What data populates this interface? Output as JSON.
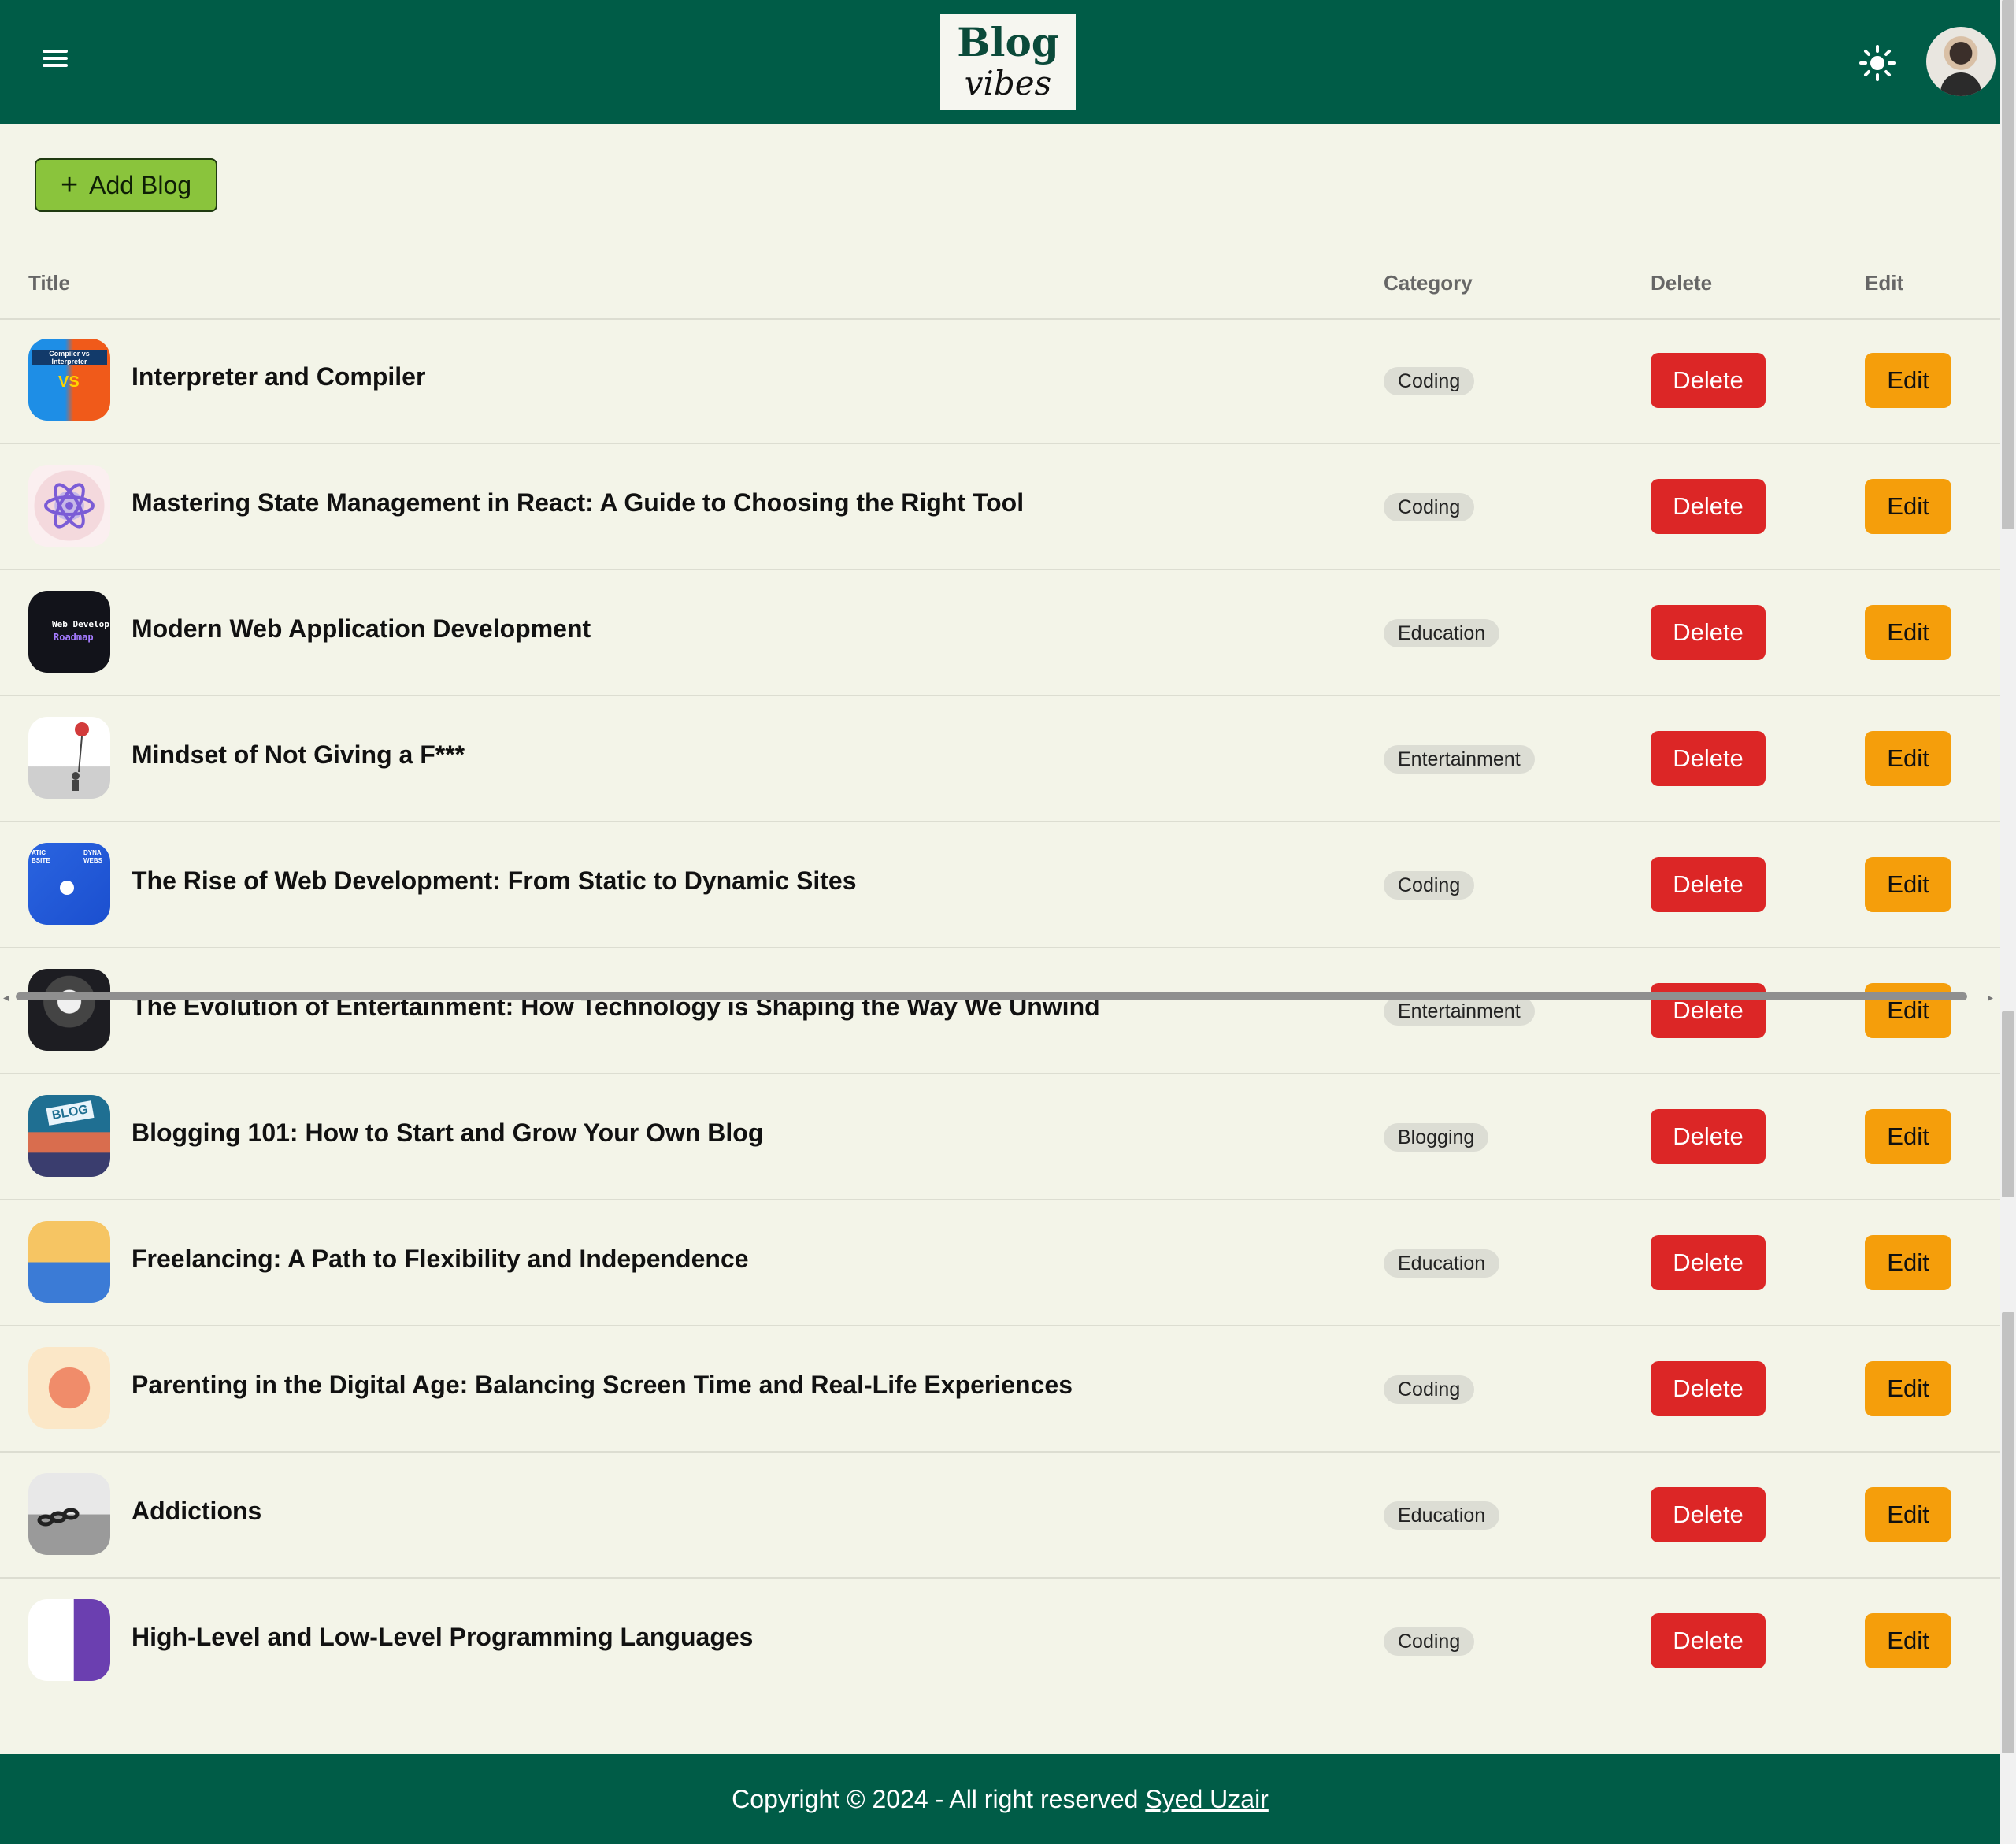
{
  "header": {
    "logo_line1": "Blog",
    "logo_line2": "vibes",
    "menu_icon": "hamburger-menu-icon",
    "theme_icon": "sun-icon",
    "bg_color": "#005c47"
  },
  "toolbar": {
    "add_label": "Add Blog",
    "add_icon": "plus-icon",
    "add_color": "#8ac43c"
  },
  "table": {
    "headers": {
      "title": "Title",
      "category": "Category",
      "delete": "Delete",
      "edit": "Edit"
    },
    "delete_label": "Delete",
    "edit_label": "Edit",
    "rows": [
      {
        "title": "Interpreter and Compiler",
        "category": "Coding"
      },
      {
        "title": "Mastering State Management in React: A Guide to Choosing the Right Tool",
        "category": "Coding"
      },
      {
        "title": "Modern Web Application Development",
        "category": "Education"
      },
      {
        "title": "Mindset of Not Giving a F***",
        "category": "Entertainment"
      },
      {
        "title": "The Rise of Web Development: From Static to Dynamic Sites",
        "category": "Coding"
      },
      {
        "title": "The Evolution of Entertainment: How Technology is Shaping the Way We Unwind",
        "category": "Entertainment"
      },
      {
        "title": "Blogging 101: How to Start and Grow Your Own Blog",
        "category": "Blogging"
      },
      {
        "title": "Freelancing: A Path to Flexibility and Independence",
        "category": "Education"
      },
      {
        "title": "Parenting in the Digital Age: Balancing Screen Time and Real-Life Experiences",
        "category": "Coding"
      },
      {
        "title": "Addictions",
        "category": "Education"
      },
      {
        "title": "High-Level and Low-Level Programming Languages",
        "category": "Coding"
      }
    ],
    "delete_color": "#dc2626",
    "edit_color": "#f59e0b"
  },
  "thumbnail_text": {
    "row1": "Compiler vs Interpreter",
    "row1_vs": "VS",
    "row3": "Web Develop",
    "row3_b": "Roadmap",
    "row5_a": "ATIC BSITE",
    "row5_b": "DYNA WEBS",
    "row7": "BLOG"
  },
  "footer": {
    "text": "Copyright © 2024 - All right reserved",
    "author": "Syed Uzair"
  }
}
